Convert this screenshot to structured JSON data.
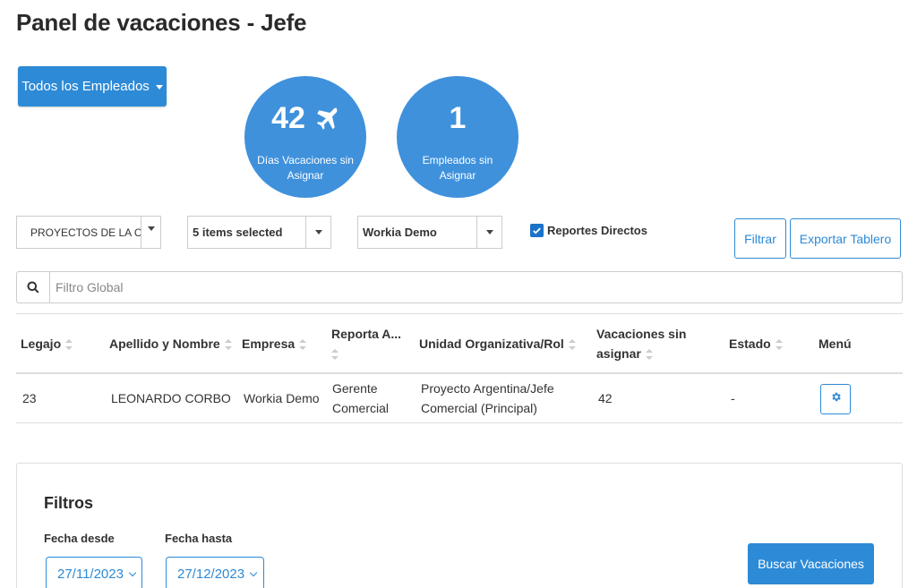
{
  "header": {
    "title": "Panel de vacaciones - Jefe"
  },
  "employee_filter": {
    "label": "Todos los Empleados"
  },
  "stats": [
    {
      "value": "42",
      "label": "Días Vacaciones sin Asignar",
      "icon": "plane-icon"
    },
    {
      "value": "1",
      "label": "Empleados sin Asignar"
    }
  ],
  "filters": {
    "project": "PROYECTOS DE LA C",
    "items": "5 items selected",
    "company": "Workia Demo",
    "direct_reports_label": "Reportes Directos",
    "direct_reports_checked": true,
    "filter_button": "Filtrar",
    "export_button": "Exportar Tablero"
  },
  "search": {
    "placeholder": "Filtro Global"
  },
  "table": {
    "headers": {
      "legajo": "Legajo",
      "nombre": "Apellido y Nombre",
      "empresa": "Empresa",
      "reporta_a": "Reporta A...",
      "unidad": "Unidad Organizativa/Rol",
      "vacaciones_1": "Vacaciones sin",
      "vacaciones_2": "asignar",
      "estado": "Estado",
      "menu": "Menú"
    },
    "rows": [
      {
        "legajo": "23",
        "nombre": "LEONARDO CORBO",
        "empresa": "Workia Demo",
        "reporta_a_1": "Gerente",
        "reporta_a_2": "Comercial",
        "unidad_1": "Proyecto Argentina/Jefe",
        "unidad_2": "Comercial (Principal)",
        "vacaciones": "42",
        "estado": "-"
      }
    ]
  },
  "bottom_filters": {
    "title": "Filtros",
    "from_label": "Fecha desde",
    "from_value": "27/11/2023",
    "to_label": "Fecha hasta",
    "to_value": "27/12/2023",
    "search_button": "Buscar Vacaciones"
  },
  "colors": {
    "primary": "#2d8ad6",
    "circle": "#3f91dc"
  }
}
